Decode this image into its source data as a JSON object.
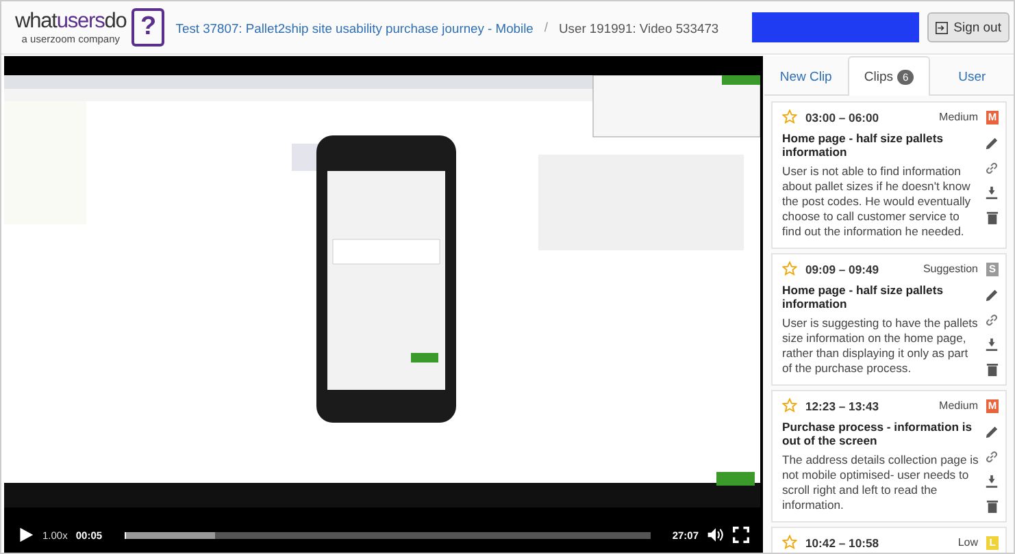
{
  "header": {
    "logo": {
      "part_1": "what",
      "part_2": "users",
      "part_3": "do",
      "tagline": "a userzoom company",
      "mark": "?"
    },
    "test_link": "Test 37807: Pallet2ship site usability purchase journey - Mobile",
    "separator": "/",
    "video_label": "User 191991: Video 533473",
    "sign_out": "Sign out"
  },
  "player": {
    "playing": false,
    "speed": "1.00x",
    "current": "00:05",
    "duration": "27:07",
    "level": 0.17
  },
  "tabs": [
    {
      "label": "New Clip",
      "selected": false
    },
    {
      "label": "Clips",
      "badge": "6",
      "selected": true
    },
    {
      "label": "User",
      "selected": false
    }
  ],
  "clips": [
    {
      "time": "03:00 – 06:00",
      "severity": "Medium",
      "letter": "M",
      "color": "#e8643c",
      "title": "Home page - half size pallets information",
      "description": "User is not able to find information about pallet sizes if he doesn't know the post codes. He would eventually choose to call customer service to find out the information he needed."
    },
    {
      "time": "09:09 – 09:49",
      "severity": "Suggestion",
      "letter": "S",
      "color": "#9a9a9a",
      "title": "Home page - half size pallets information",
      "description": "User is suggesting to have the pallets size information on the home page, rather than displaying it only as part of the purchase process."
    },
    {
      "time": "12:23 – 13:43",
      "severity": "Medium",
      "letter": "M",
      "color": "#e8643c",
      "title": "Purchase process - information is out of the screen",
      "description": "The address details collection page is not mobile optimised- user needs to scroll right and left to read the information."
    },
    {
      "time": "10:42 – 10:58",
      "severity": "Low",
      "letter": "L",
      "color": "#f0d23a"
    }
  ]
}
